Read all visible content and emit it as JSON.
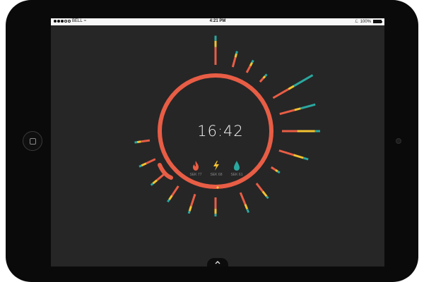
{
  "status_bar": {
    "carrier": "BELL",
    "time": "4:21 PM",
    "battery": "100%",
    "battery_level": 1.0,
    "signal_bars_filled": 3,
    "signal_bars_total": 5
  },
  "clock": {
    "time": "16:42"
  },
  "utilities": [
    {
      "icon": "flame-icon",
      "label": "SEK 77",
      "color": "#e85d45"
    },
    {
      "icon": "lightning-icon",
      "label": "SEK 68",
      "color": "#f2c230"
    },
    {
      "icon": "water-drop-icon",
      "label": "SEK 61",
      "color": "#2aa8a0"
    }
  ],
  "colors": {
    "ring": "#e85d45",
    "electricity": "#f2c230",
    "water": "#2aa8a0",
    "background": "#262626"
  },
  "usage_ticks": [
    {
      "segments": [
        0.14,
        0.05,
        0.04
      ]
    },
    {
      "segments": [
        0.08,
        0.03,
        0.02
      ]
    },
    {
      "segments": [
        0.06,
        0.03,
        0.02
      ]
    },
    {
      "segments": [
        0.04,
        0.02,
        0.02
      ]
    },
    {
      "segments": [
        0.14,
        0.05,
        0.17
      ]
    },
    {
      "segments": [
        0.12,
        0.05,
        0.12
      ]
    },
    {
      "segments": [
        0.12,
        0.14,
        0.04
      ]
    },
    {
      "segments": [
        0.12,
        0.08,
        0.04
      ]
    },
    {
      "segments": [
        0.04,
        0.02,
        0.02
      ]
    },
    {
      "segments": [
        0.08,
        0.05,
        0.02
      ]
    },
    {
      "segments": [
        0.1,
        0.04,
        0.03
      ]
    },
    {
      "segments": [
        0.09,
        0.04,
        0.02
      ]
    },
    {
      "segments": [
        0.1,
        0.04,
        0.02
      ]
    },
    {
      "segments": [
        0.09,
        0.04,
        0.02
      ]
    },
    {
      "segments": [
        0.08,
        0.04,
        0.02
      ]
    },
    {
      "segments": [
        0.08,
        0.04,
        0.02
      ]
    },
    {
      "segments": [
        0.07,
        0.03,
        0.02
      ]
    }
  ]
}
